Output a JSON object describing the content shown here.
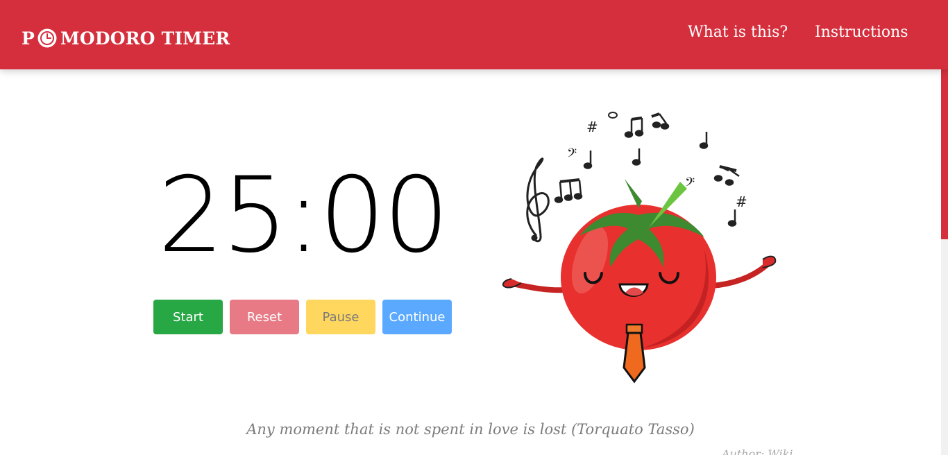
{
  "nav": {
    "brand_prefix": "P",
    "brand_suffix": "MODORO TIMER",
    "brand_icon": "clock-icon",
    "links": [
      "What is this?",
      "Instructions"
    ]
  },
  "timer": {
    "display": "25:00"
  },
  "buttons": {
    "start": "Start",
    "reset": "Reset",
    "pause": "Pause",
    "continue": "Continue"
  },
  "quote": {
    "text": "Any moment that is not spent in love is lost (Torquato Tasso)",
    "author": "Author: Wiki"
  },
  "colors": {
    "nav_bg": "#d52f3d",
    "start": "#28a745",
    "reset": "#e87a85",
    "pause": "#ffd75e",
    "continue": "#5aa9ff"
  },
  "illustration": "singing-tomato-mascot"
}
